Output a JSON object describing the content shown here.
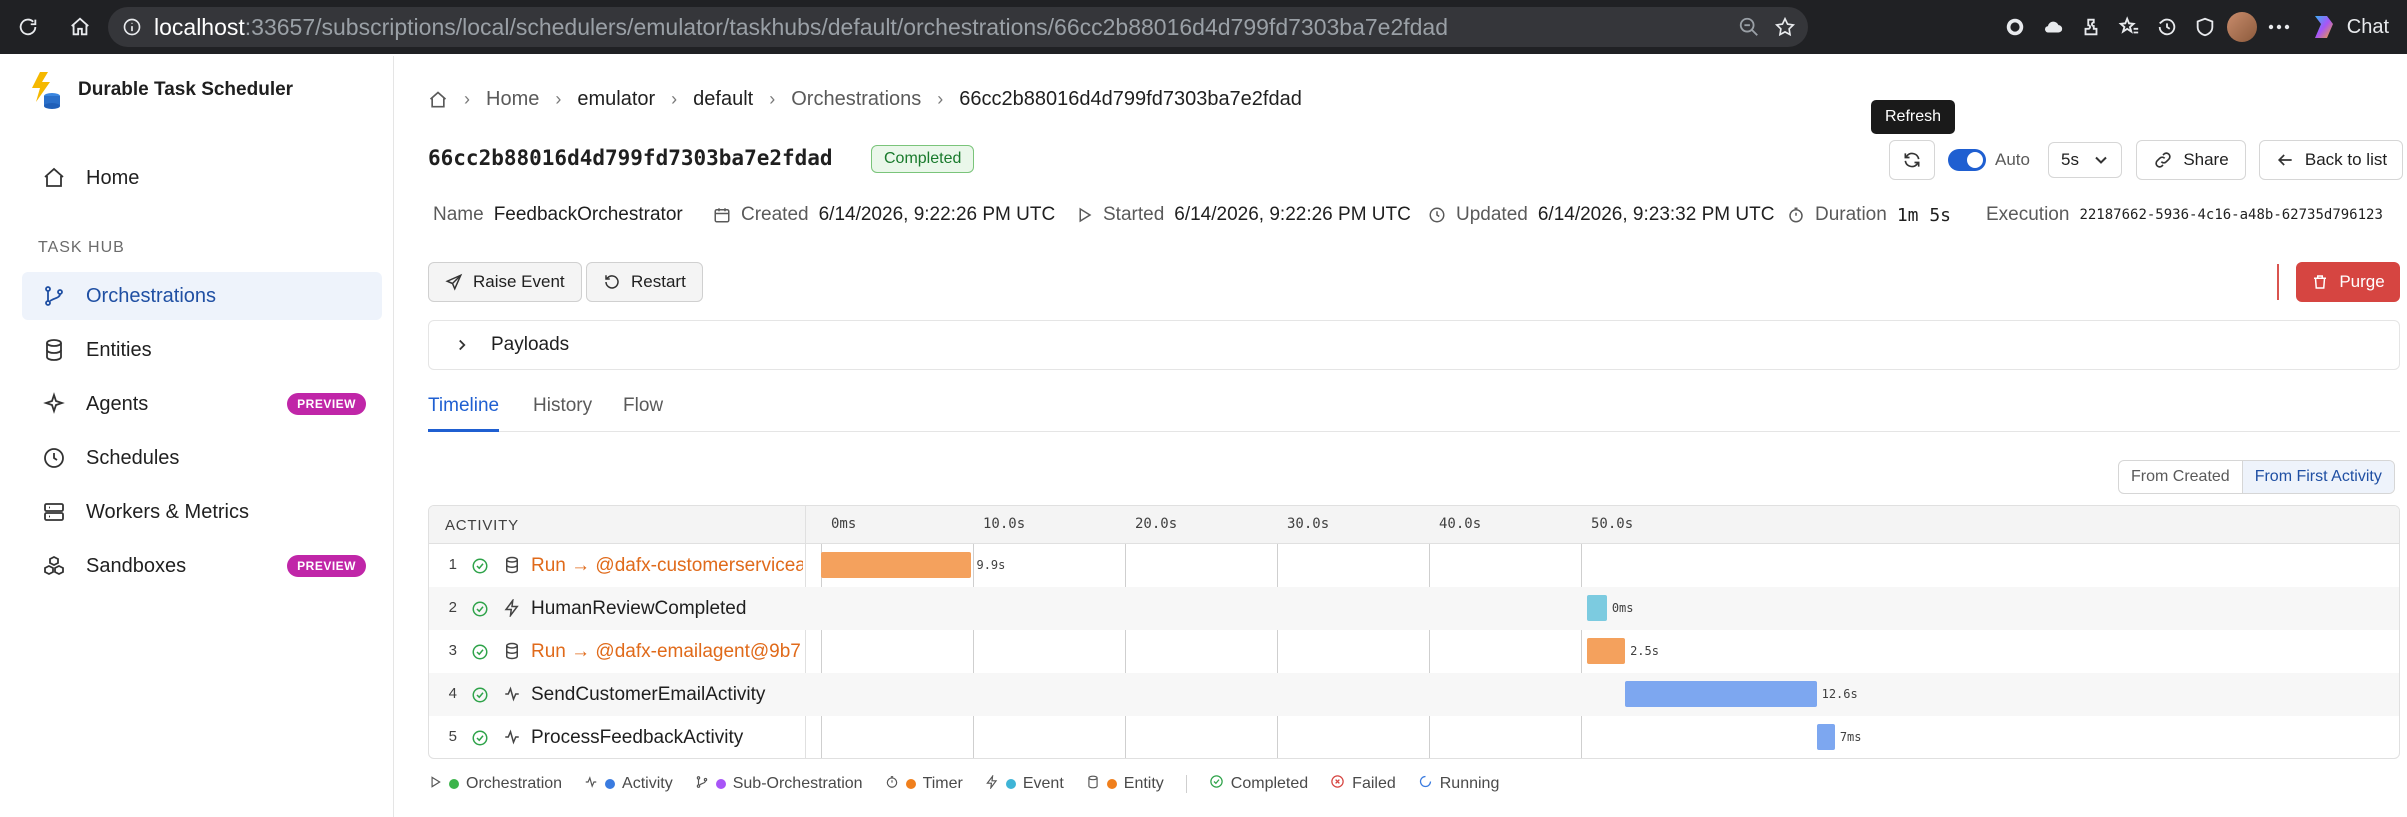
{
  "browser": {
    "url_host": "localhost",
    "url_rest": ":33657/subscriptions/local/schedulers/emulator/taskhubs/default/orchestrations/66cc2b88016d4d799fd7303ba7e2fdad",
    "chat_label": "Chat"
  },
  "sidebar": {
    "brand": "Durable Task Scheduler",
    "home": "Home",
    "section": "TASK HUB",
    "items": [
      {
        "label": "Orchestrations"
      },
      {
        "label": "Entities"
      },
      {
        "label": "Agents",
        "badge": "PREVIEW"
      },
      {
        "label": "Schedules"
      },
      {
        "label": "Workers & Metrics"
      },
      {
        "label": "Sandboxes",
        "badge": "PREVIEW"
      }
    ]
  },
  "breadcrumb": [
    "Home",
    "emulator",
    "default",
    "Orchestrations",
    "66cc2b88016d4d799fd7303ba7e2fdad"
  ],
  "header": {
    "title": "66cc2b88016d4d799fd7303ba7e2fdad",
    "status": "Completed",
    "tooltip": "Refresh",
    "auto_label": "Auto",
    "interval": "5s",
    "share": "Share",
    "back": "Back to list"
  },
  "meta": {
    "name_label": "Name",
    "name": "FeedbackOrchestrator",
    "created_label": "Created",
    "created": "6/14/2026, 9:22:26 PM UTC",
    "started_label": "Started",
    "started": "6/14/2026, 9:22:26 PM UTC",
    "updated_label": "Updated",
    "updated": "6/14/2026, 9:23:32 PM UTC",
    "duration_label": "Duration",
    "duration": "1m 5s",
    "execution_label": "Execution",
    "execution": "22187662-5936-4c16-a48b-62735d796123"
  },
  "actions": {
    "raise": "Raise Event",
    "restart": "Restart",
    "purge": "Purge"
  },
  "payloads_label": "Payloads",
  "tabs": [
    "Timeline",
    "History",
    "Flow"
  ],
  "view_toggle": {
    "from_created": "From Created",
    "from_first": "From First Activity"
  },
  "timeline": {
    "column_label": "ACTIVITY",
    "ticks": [
      "0ms",
      "10.0s",
      "20.0s",
      "30.0s",
      "40.0s",
      "50.0s"
    ],
    "rows": [
      {
        "n": "1",
        "name": "Run → @dafx-customerservicea",
        "type": "entity",
        "start_s": 0,
        "dur_label": "9.9s",
        "dur_s": 9.9,
        "color": "#f4a15d"
      },
      {
        "n": "2",
        "name": "HumanReviewCompleted",
        "type": "event",
        "start_s": 50.4,
        "dur_label": "0ms",
        "dur_s": 1.3,
        "color": "#7ccbe0"
      },
      {
        "n": "3",
        "name": "Run → @dafx-emailagent@9b7",
        "type": "entity",
        "start_s": 50.4,
        "dur_label": "2.5s",
        "dur_s": 2.5,
        "color": "#f4a15d"
      },
      {
        "n": "4",
        "name": "SendCustomerEmailActivity",
        "type": "activity",
        "start_s": 52.9,
        "dur_label": "12.6s",
        "dur_s": 12.6,
        "color": "#7da7f0"
      },
      {
        "n": "5",
        "name": "ProcessFeedbackActivity",
        "type": "activity",
        "start_s": 65.5,
        "dur_label": "7ms",
        "dur_s": 1.2,
        "color": "#7da7f0"
      }
    ]
  },
  "legend": {
    "items": [
      {
        "label": "Orchestration",
        "color": "#3cb44b"
      },
      {
        "label": "Activity",
        "color": "#3a7be0"
      },
      {
        "label": "Sub-Orchestration",
        "color": "#a855f7"
      },
      {
        "label": "Timer",
        "color": "#f07f1c"
      },
      {
        "label": "Event",
        "color": "#3fb4d6"
      },
      {
        "label": "Entity",
        "color": "#f07f1c"
      }
    ],
    "status": [
      "Completed",
      "Failed",
      "Running"
    ]
  }
}
